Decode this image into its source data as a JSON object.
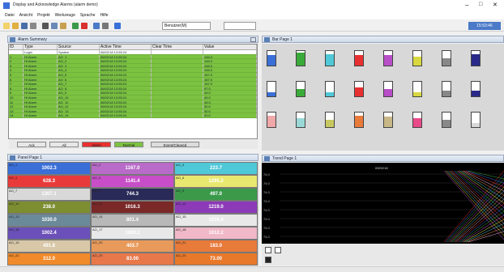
{
  "title": "Display and Acknowledge Alarms (alarm demo)",
  "menu": [
    "Datei",
    "Ansicht",
    "Projekt",
    "Werkzeuge",
    "Sprache",
    "Hilfe"
  ],
  "toolbar": {
    "dropdown": "Benutzer(M)",
    "time": "15:53:46"
  },
  "panels": {
    "alarm_list": "Alarm Summary",
    "bar_page": "Bar Page 1",
    "panel_page": "Panel Page 1",
    "trend_page": "Trend Page 1"
  },
  "alarm_table": {
    "columns": [
      "ID",
      "Type",
      "Source",
      "Active Time",
      "Clear Time",
      "Value"
    ],
    "rows": [
      [
        "",
        "Login",
        "System",
        "06/02/18 13:55:24",
        "",
        ""
      ],
      [
        "1",
        "HI Alarm",
        "AO_1",
        "06/02/18 13:55:24",
        "",
        "146.0"
      ],
      [
        "2",
        "HI Alarm",
        "AO_2",
        "06/02/18 13:55:24",
        "",
        "146.0"
      ],
      [
        "3",
        "HI Alarm",
        "AO_3",
        "06/02/18 13:55:24",
        "",
        "146.0"
      ],
      [
        "4",
        "HI Alarm",
        "AO_4",
        "06/02/18 13:55:24",
        "",
        "146.0"
      ],
      [
        "5",
        "HI Alarm",
        "AO_5",
        "06/02/18 13:55:24",
        "",
        "157.0"
      ],
      [
        "6",
        "HI Alarm",
        "AO_6",
        "06/02/18 13:55:24",
        "",
        "157.0"
      ],
      [
        "7",
        "HI Alarm",
        "AO_7",
        "06/02/18 13:55:24",
        "",
        "157.0"
      ],
      [
        "8",
        "HI Alarm",
        "AO_8",
        "06/02/18 13:55:24",
        "",
        "97.0"
      ],
      [
        "9",
        "HI Alarm",
        "AO_9",
        "06/02/18 13:55:24",
        "",
        "44.0"
      ],
      [
        "10",
        "HI Alarm",
        "AO_10",
        "06/02/18 13:55:24",
        "",
        "44.0"
      ],
      [
        "11",
        "HI Alarm",
        "AO_11",
        "06/02/18 13:55:24",
        "",
        "44.0"
      ],
      [
        "12",
        "HI Alarm",
        "AO_12",
        "06/02/18 13:55:24",
        "",
        "30.0"
      ],
      [
        "13",
        "HI Alarm",
        "AO_13",
        "06/02/18 13:55:24",
        "",
        "30.0"
      ],
      [
        "14",
        "HI Alarm",
        "AO_14",
        "06/02/18 13:55:24",
        "",
        "20.0"
      ]
    ]
  },
  "legend": [
    "Ack",
    "All",
    "Alarm",
    "Normal",
    "Event/Cleared"
  ],
  "legend_colors": [
    "#e8e8e8",
    "#e8e8e8",
    "#e83030",
    "#7cc241",
    "#dcdcdc"
  ],
  "tiles": [
    {
      "label": "AO_1",
      "value": "1002.3",
      "color": "#3a6fd8"
    },
    {
      "label": "AO_2",
      "value": "1167.0",
      "color": "#b86bc8"
    },
    {
      "label": "AO_3",
      "value": "223.7",
      "color": "#4fc8d8"
    },
    {
      "label": "AO_4",
      "value": "628.3",
      "color": "#e83a3a"
    },
    {
      "label": "AO_5",
      "value": "1141.4",
      "color": "#c84ec8"
    },
    {
      "label": "AO_6",
      "value": "1295.2",
      "color": "#e8e870"
    },
    {
      "label": "AO_7",
      "value": "1307.1",
      "color": "#d8d8d8"
    },
    {
      "label": "AO_8",
      "value": "744.3",
      "color": "#2a2a58"
    },
    {
      "label": "AO_9",
      "value": "497.0",
      "color": "#3a9a4a"
    },
    {
      "label": "AO_10",
      "value": "238.0",
      "color": "#7c8e30"
    },
    {
      "label": "AO_11",
      "value": "1016.3",
      "color": "#7a2828"
    },
    {
      "label": "AO_12",
      "value": "1219.0",
      "color": "#8c3ab8"
    },
    {
      "label": "AO_13",
      "value": "1030.0",
      "color": "#6a8a9a"
    },
    {
      "label": "AO_14",
      "value": "801.4",
      "color": "#b8b8b8"
    },
    {
      "label": "AO_15",
      "value": "1016.4",
      "color": "#e8e8e8"
    },
    {
      "label": "AO_16",
      "value": "1002.4",
      "color": "#6a50b8"
    },
    {
      "label": "AO_17",
      "value": "1000.1",
      "color": "#e8e8e8"
    },
    {
      "label": "AO_18",
      "value": "1012.2",
      "color": "#f0b8c8"
    },
    {
      "label": "AO_19",
      "value": "491.8",
      "color": "#d8c8a8"
    },
    {
      "label": "AO_20",
      "value": "403.7",
      "color": "#e89a5a"
    },
    {
      "label": "AO_21",
      "value": "183.0",
      "color": "#e87a3a"
    },
    {
      "label": "AO_22",
      "value": "312.0",
      "color": "#f08a2a"
    },
    {
      "label": "AO_23",
      "value": "83.00",
      "color": "#e8784a"
    },
    {
      "label": "AO_24",
      "value": "73.00",
      "color": "#e8782a"
    }
  ],
  "bars": [
    {
      "fill": 0.7,
      "color": "#3a6fd8"
    },
    {
      "fill": 0.9,
      "color": "#3aaa3a"
    },
    {
      "fill": 0.8,
      "color": "#4fc8d8"
    },
    {
      "fill": 0.75,
      "color": "#e83030"
    },
    {
      "fill": 0.7,
      "color": "#b84ec8"
    },
    {
      "fill": 0.6,
      "color": "#d8d840"
    },
    {
      "fill": 0.5,
      "color": "#888"
    },
    {
      "fill": 0.8,
      "color": "#2a2a8a"
    },
    {
      "fill": 0.3,
      "color": "#3a6fd8"
    },
    {
      "fill": 0.5,
      "color": "#3aaa3a"
    },
    {
      "fill": 0.3,
      "color": "#4fc8d8"
    },
    {
      "fill": 0.6,
      "color": "#e83030"
    },
    {
      "fill": 0.5,
      "color": "#b84ec8"
    },
    {
      "fill": 0.3,
      "color": "#d8d840"
    },
    {
      "fill": 0.4,
      "color": "#888"
    },
    {
      "fill": 0.4,
      "color": "#2a2a8a"
    },
    {
      "fill": 0.8,
      "color": "#f0a8a8"
    },
    {
      "fill": 0.6,
      "color": "#9ad8d8"
    },
    {
      "fill": 0.5,
      "color": "#c8c860"
    },
    {
      "fill": 0.8,
      "color": "#e87a3a"
    },
    {
      "fill": 0.7,
      "color": "#c8b888"
    },
    {
      "fill": 0.6,
      "color": "#e84a8a"
    },
    {
      "fill": 0.5,
      "color": "#888"
    },
    {
      "fill": 0.3,
      "color": "#d8d8d8"
    }
  ],
  "trend": {
    "date": "09/02/18",
    "ylabels": [
      "74.0",
      "74.0",
      "74.0",
      "74.0",
      "74.0",
      "74.0",
      "74.0",
      "74.0"
    ]
  }
}
